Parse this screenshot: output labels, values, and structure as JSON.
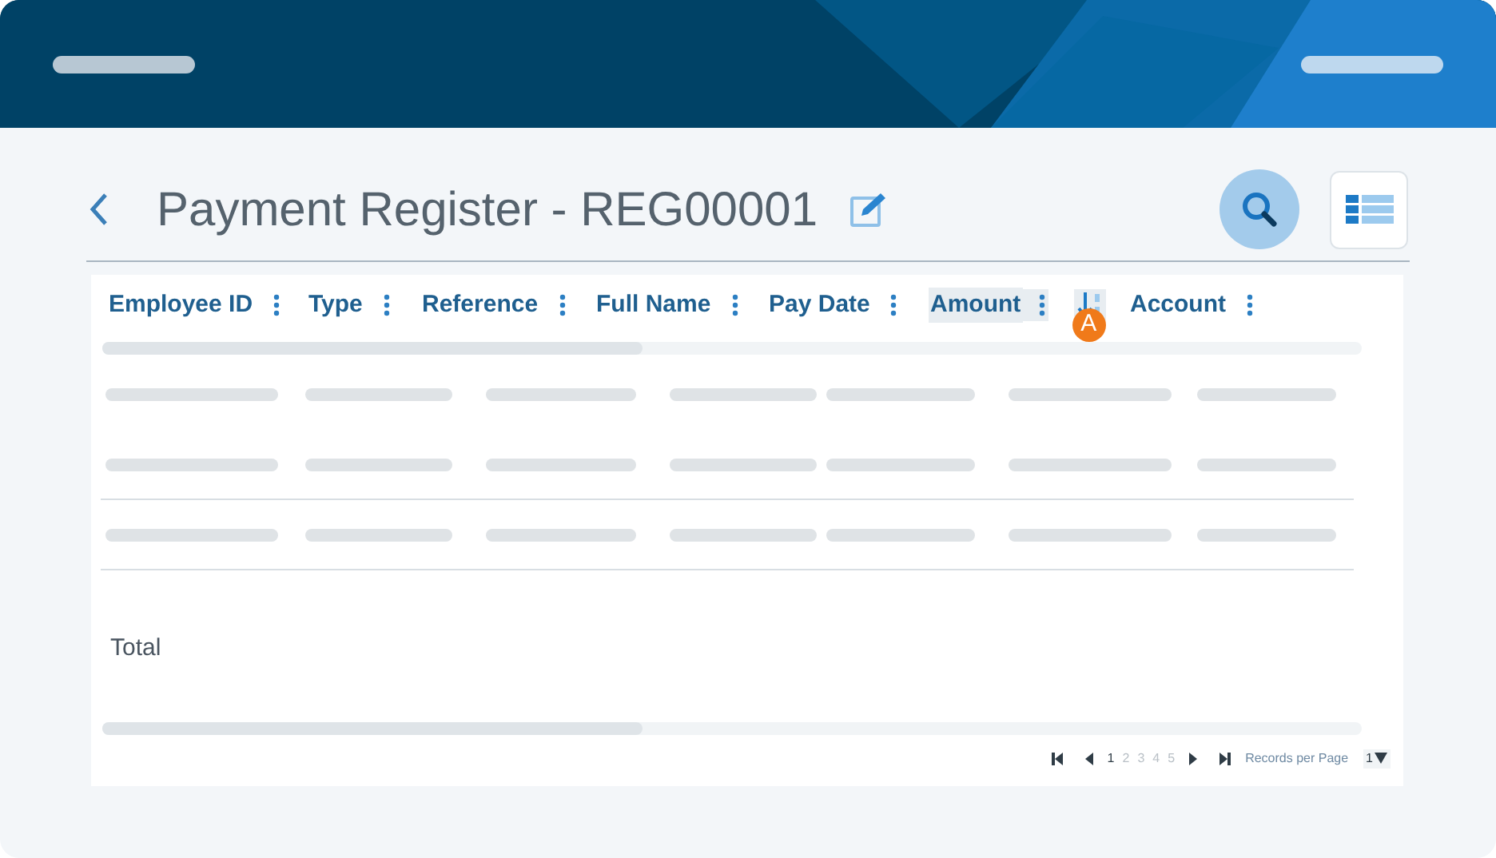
{
  "page": {
    "title": "Payment Register - REG00001"
  },
  "table": {
    "columns": [
      {
        "label": "Employee ID",
        "selected": false
      },
      {
        "label": "Type",
        "selected": false
      },
      {
        "label": "Reference",
        "selected": false
      },
      {
        "label": "Full Name",
        "selected": false
      },
      {
        "label": "Pay Date",
        "selected": false
      },
      {
        "label": "Amount",
        "selected": true,
        "sorted": true
      },
      {
        "label": "Account",
        "selected": false
      }
    ],
    "sort_badge": "A",
    "total_label": "Total"
  },
  "pagination": {
    "pages": [
      {
        "label": "1",
        "selected": true
      },
      {
        "label": "2",
        "selected": false
      },
      {
        "label": "3",
        "selected": false
      },
      {
        "label": "4",
        "selected": false
      },
      {
        "label": "5",
        "selected": false
      }
    ],
    "records_label": "Records per Page",
    "records_value": "1"
  }
}
